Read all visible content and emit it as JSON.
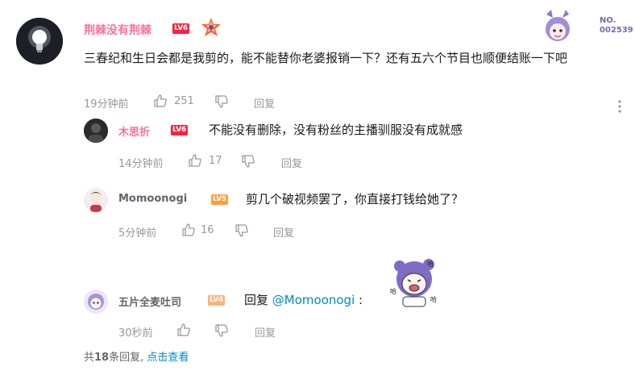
{
  "main_comment": {
    "username": "荆棘没有荆棘",
    "level": "LV6",
    "content": "三春纪和生日会都是我剪的，能不能替你老婆报销一下？还有五六个节目也顺便结账一下吧",
    "time": "19分钟前",
    "likes": "251",
    "reply_label": "回复",
    "fan_card_number": "NO.\n002539",
    "username_color": "#fb7299"
  },
  "replies": [
    {
      "username": "木思折",
      "level": "LV6",
      "content": "不能没有删除，没有粉丝的主播驯服没有成就感",
      "time": "14分钟前",
      "likes": "17",
      "reply_label": "回复",
      "username_color": "#fb7299"
    },
    {
      "username": "Momoonogi",
      "level": "LV5",
      "content": "剪几个破视频罢了，你直接打钱给她了？",
      "time": "5分钟前",
      "likes": "16",
      "reply_label": "回复",
      "username_color": "#61666d"
    },
    {
      "username": "五片全麦吐司",
      "level": "LV4",
      "content_prefix": "回复 ",
      "mention": "@Momoonogi",
      "content_suffix": " :",
      "time": "30秒前",
      "reply_label": "回复",
      "username_color": "#61666d"
    }
  ],
  "footer": {
    "count_prefix": "共",
    "count": "18",
    "count_suffix": "条回复, ",
    "view_link": "点击查看"
  },
  "colors": {
    "link": "#008ac5",
    "meta": "#9499a0",
    "lv6": "#ff1f3d",
    "lv5": "#ff9e3a",
    "lv4": "#ffb27a"
  }
}
